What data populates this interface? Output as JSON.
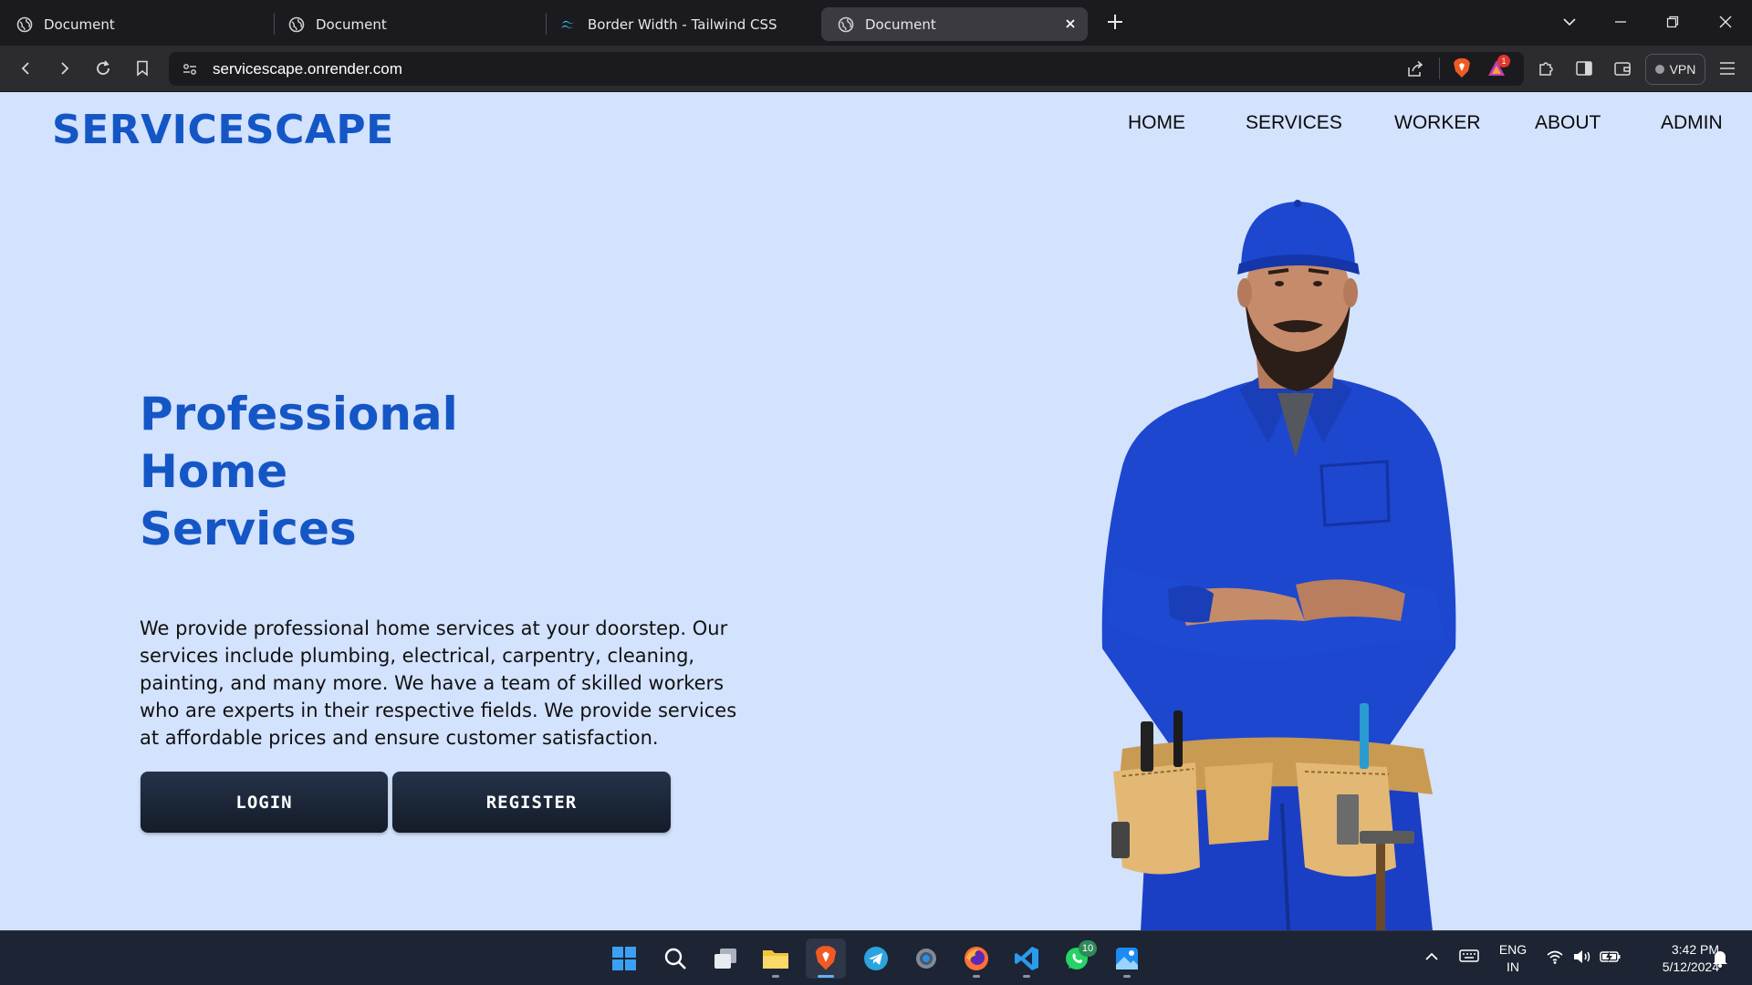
{
  "browser": {
    "tabs": [
      {
        "title": "Document",
        "active": false
      },
      {
        "title": "Document",
        "active": false
      },
      {
        "title": "Border Width - Tailwind CSS",
        "active": false
      },
      {
        "title": "Document",
        "active": true
      }
    ],
    "url": "servicescape.onrender.com",
    "shields_badge": "1",
    "vpn_label": "VPN"
  },
  "page": {
    "brand": "SERVICESCAPE",
    "nav": [
      "HOME",
      "SERVICES",
      "WORKER",
      "ABOUT",
      "ADMIN"
    ],
    "hero_title_lines": [
      "Professional",
      "Home",
      "Services"
    ],
    "hero_description": "We provide professional home services at your doorstep. Our services include plumbing, electrical, carpentry, cleaning, painting, and many more. We have a team of skilled workers who are experts in their respective fields. We provide services at affordable prices and ensure customer satisfaction.",
    "login_label": "LOGIN",
    "register_label": "REGISTER",
    "colors": {
      "background": "#d3e2fd",
      "brand": "#1556c6",
      "button": "#1a2231"
    }
  },
  "taskbar": {
    "apps": [
      "windows-start",
      "search",
      "task-view",
      "file-explorer",
      "brave",
      "telegram",
      "settings",
      "firefox",
      "vscode",
      "whatsapp",
      "photos"
    ],
    "whatsapp_badge": "10",
    "language": "ENG",
    "region": "IN",
    "time": "3:42 PM",
    "date": "5/12/2024"
  }
}
